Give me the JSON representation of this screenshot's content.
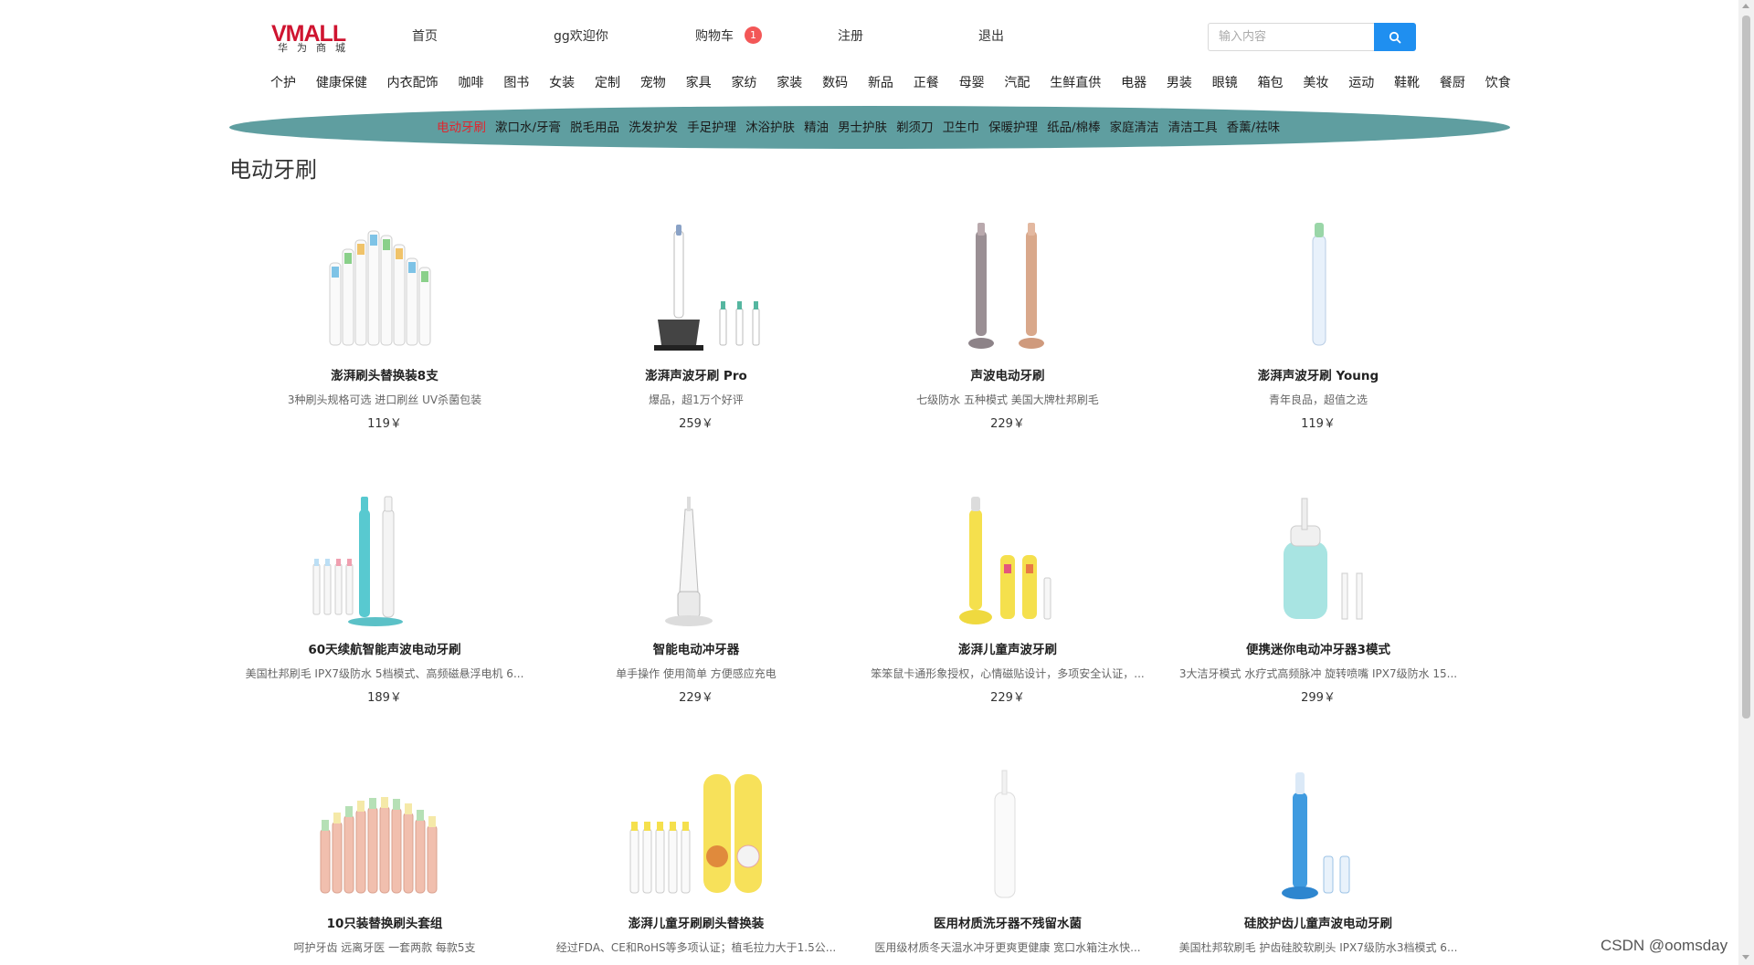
{
  "header": {
    "logo_main": "VMALL",
    "logo_sub": "华为商城",
    "nav": [
      "首页",
      "gg欢迎你",
      "购物车",
      "注册",
      "退出"
    ],
    "cart_count": "1",
    "search_placeholder": "输入内容"
  },
  "categories": [
    "个护",
    "健康保健",
    "内衣配饰",
    "咖啡",
    "图书",
    "女装",
    "定制",
    "宠物",
    "家具",
    "家纺",
    "家装",
    "数码",
    "新品",
    "正餐",
    "母婴",
    "汽配",
    "生鲜直供",
    "电器",
    "男装",
    "眼镜",
    "箱包",
    "美妆",
    "运动",
    "鞋靴",
    "餐厨",
    "饮食"
  ],
  "subcategories": [
    "电动牙刷",
    "漱口水/牙膏",
    "脱毛用品",
    "洗发护发",
    "手足护理",
    "沐浴护肤",
    "精油",
    "男士护肤",
    "剃须刀",
    "卫生巾",
    "保暖护理",
    "纸品/棉棒",
    "家庭清洁",
    "清洁工具",
    "香薰/祛味"
  ],
  "section_title": "电动牙刷",
  "products": [
    {
      "name": "澎湃刷头替换装8支",
      "desc": "3种刷头规格可选 进口刷丝 UV杀菌包装",
      "price": "119￥",
      "icon": "brush-heads-image"
    },
    {
      "name": "澎湃声波牙刷 Pro",
      "desc": "爆品，超1万个好评",
      "price": "259￥",
      "icon": "sonic-toothbrush-pro-image"
    },
    {
      "name": "声波电动牙刷",
      "desc": "七级防水 五种模式 美国大牌杜邦刷毛",
      "price": "229￥",
      "icon": "pair-toothbrush-image"
    },
    {
      "name": "澎湃声波牙刷 Young",
      "desc": "青年良品，超值之选",
      "price": "119￥",
      "icon": "toothbrush-young-image"
    },
    {
      "name": "60天续航智能声波电动牙刷",
      "desc": "美国杜邦刷毛 IPX7级防水 5档模式、高频磁悬浮电机 6...",
      "price": "189￥",
      "icon": "toothbrush-set-image"
    },
    {
      "name": "智能电动冲牙器",
      "desc": "单手操作 使用简单 方便感应充电",
      "price": "229￥",
      "icon": "water-flosser-image"
    },
    {
      "name": "澎湃儿童声波牙刷",
      "desc": "笨笨鼠卡通形象授权，心情磁贴设计，多项安全认证，...",
      "price": "229￥",
      "icon": "kids-toothbrush-image"
    },
    {
      "name": "便携迷你电动冲牙器3模式",
      "desc": "3大洁牙模式 水疗式高频脉冲 旋转喷嘴 IPX7级防水 15...",
      "price": "299￥",
      "icon": "portable-flosser-image"
    },
    {
      "name": "10只装替换刷头套组",
      "desc": "呵护牙齿 远离牙医 一套两款 每款5支",
      "price": "",
      "icon": "pink-brush-heads-image"
    },
    {
      "name": "澎湃儿童牙刷刷头替换装",
      "desc": "经过FDA、CE和RoHS等多项认证；植毛拉力大于1.5公...",
      "price": "",
      "icon": "kids-brush-heads-image"
    },
    {
      "name": "医用材质洗牙器不残留水菌",
      "desc": "医用级材质冬天温水冲牙更爽更健康 宽口水箱注水快...",
      "price": "",
      "icon": "medical-flosser-image"
    },
    {
      "name": "硅胶护齿儿童声波电动牙刷",
      "desc": "美国杜邦软刷毛 护齿硅胶软刷头 IPX7级防水3档模式 6...",
      "price": "",
      "icon": "silicone-kids-toothbrush-image"
    }
  ],
  "watermark": "CSDN @oomsday",
  "colors": {
    "accent": "#1f8ff0",
    "banner": "#5f9ea0",
    "active": "#e0262e",
    "logo": "#cf1430",
    "badge": "#f35757"
  }
}
